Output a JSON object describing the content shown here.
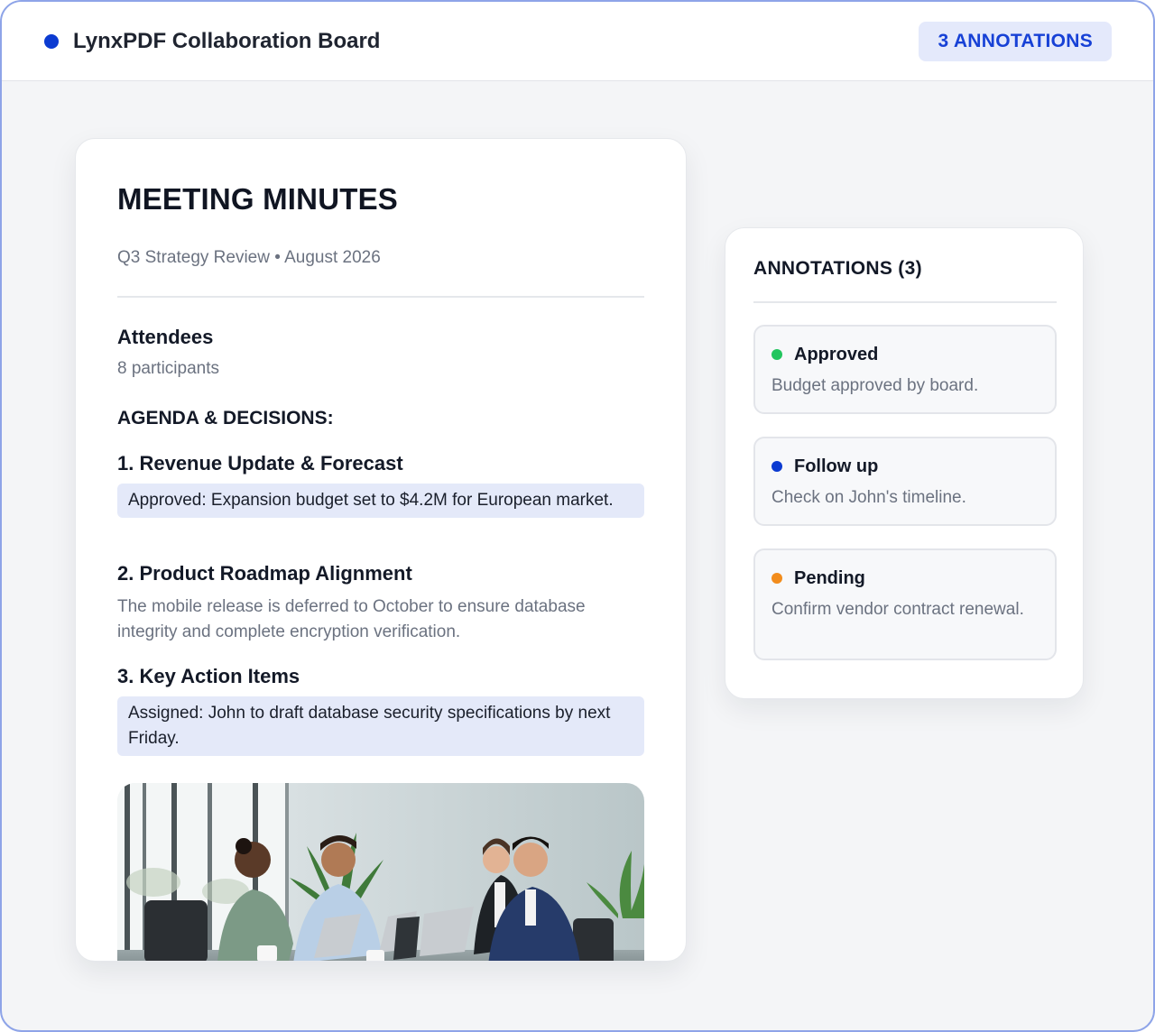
{
  "header": {
    "app_title": "LynxPDF Collaboration Board",
    "annotations_badge": "3 ANNOTATIONS",
    "brand_color": "#0c3bd1"
  },
  "document": {
    "title": "MEETING MINUTES",
    "subtitle": "Q3 Strategy Review • August 2026",
    "attendees_heading": "Attendees",
    "attendees_count": "8 participants",
    "agenda_heading": "AGENDA & DECISIONS:",
    "items": [
      {
        "heading": "1. Revenue Update & Forecast",
        "text": "Approved: Expansion budget set to $4.2M for European market.",
        "highlighted": true
      },
      {
        "heading": "2. Product Roadmap Alignment",
        "text": "The mobile release is deferred to October to ensure database integrity and complete encryption verification.",
        "highlighted": false
      },
      {
        "heading": "3. Key Action Items",
        "text": "Assigned: John to draft database security specifications by next Friday.",
        "highlighted": true
      }
    ],
    "image": "meeting-photo"
  },
  "annotations_panel": {
    "title": "ANNOTATIONS (3)",
    "notes": [
      {
        "label": "Approved",
        "text": "Budget approved by board.",
        "color": "#22c55e"
      },
      {
        "label": "Follow up",
        "text": "Check on John's timeline.",
        "color": "#0c3bd1"
      },
      {
        "label": "Pending",
        "text": "Confirm vendor contract renewal.",
        "color": "#f28c1c"
      }
    ]
  }
}
